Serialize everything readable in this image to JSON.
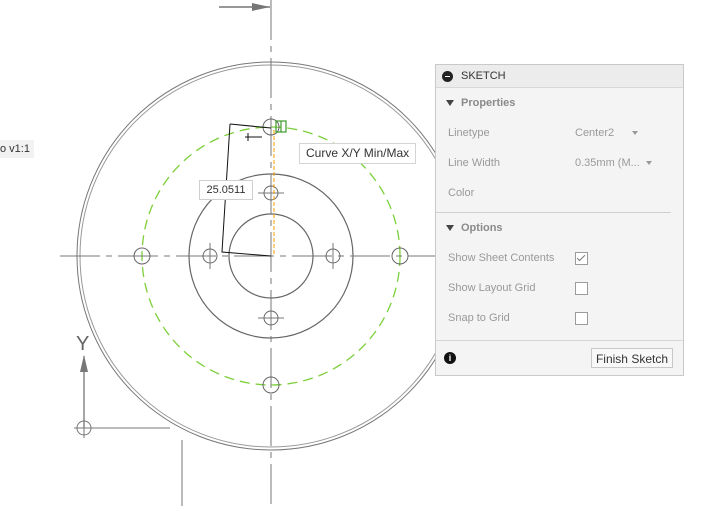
{
  "browser_item": {
    "label": "o v1:1"
  },
  "dimension": {
    "value": "25.0511"
  },
  "tooltip": {
    "text": "Curve X/Y Min/Max"
  },
  "axis": {
    "y_label": "Y"
  },
  "sketch_panel": {
    "title": "SKETCH",
    "properties": {
      "heading": "Properties",
      "linetype": {
        "label": "Linetype",
        "value": "Center2"
      },
      "line_width": {
        "label": "Line Width",
        "value": "0.35mm (M..."
      },
      "color": {
        "label": "Color"
      }
    },
    "options": {
      "heading": "Options",
      "show_sheet_contents": {
        "label": "Show Sheet Contents",
        "checked": true
      },
      "show_layout_grid": {
        "label": "Show Layout Grid",
        "checked": false
      },
      "snap_to_grid": {
        "label": "Snap to Grid",
        "checked": false
      }
    },
    "finish_button": "Finish Sketch"
  },
  "colors": {
    "geometry": "#777777",
    "construction": "#7ccf3a",
    "accent": "#f0a000"
  }
}
